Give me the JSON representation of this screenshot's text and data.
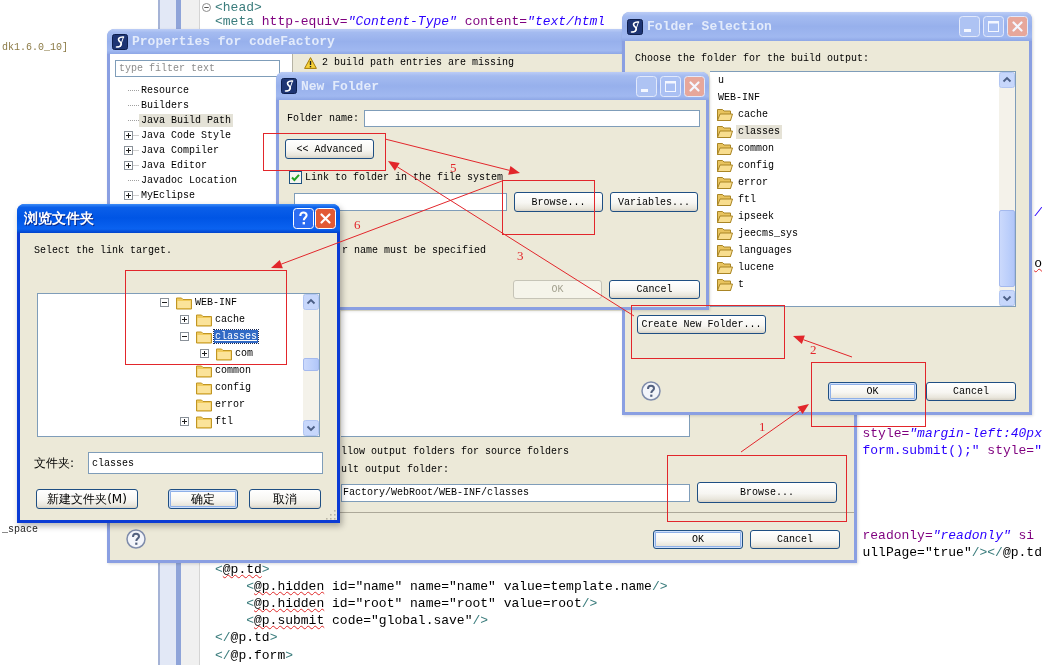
{
  "editor": {
    "left_view": {
      "lines": [
        {
          "text": "dk1.6.0_10]",
          "kind": "decoration"
        },
        {
          "text": "_space",
          "kind": "name"
        }
      ]
    },
    "code_lines": [
      {
        "expanded": true,
        "parts": [
          {
            "kind": "tag",
            "text": "<head>",
            "warning": false
          }
        ]
      },
      {
        "parts": [
          {
            "kind": "tag",
            "text": "<meta",
            "warning": false
          },
          {
            "kind": "attr",
            "text": " http-equiv=",
            "warning": false
          },
          {
            "kind": "value",
            "text": "\"Content-Type\"",
            "warning": false
          },
          {
            "kind": "attr",
            "text": " content=",
            "warning": false
          },
          {
            "kind": "value",
            "text": "\"text/html",
            "warning": false
          }
        ]
      },
      {
        "parts": [
          {
            "kind": "value",
            "text": "/",
            "warning": false
          }
        ]
      },
      {
        "parts": [
          {
            "kind": "text",
            "text": "o",
            "warning": true
          }
        ]
      },
      {
        "parts": [
          {
            "kind": "attr",
            "text": "style=",
            "warning": false
          },
          {
            "kind": "value",
            "text": "\"margin-left:40px",
            "warning": false
          }
        ]
      },
      {
        "parts": [
          {
            "kind": "script",
            "text": "form.submit();\"",
            "warning": false
          },
          {
            "kind": "attr",
            "text": " style=",
            "warning": false
          },
          {
            "kind": "script",
            "text": "\"",
            "warning": false
          }
        ]
      },
      {
        "parts": [
          {
            "kind": "attr",
            "text": "readonly=",
            "warning": false
          },
          {
            "kind": "value",
            "text": "\"readonly\"",
            "warning": false
          },
          {
            "kind": "attr",
            "text": " si",
            "warning": false
          }
        ]
      },
      {
        "parts": [
          {
            "kind": "text",
            "text": "ullPage=\"true\"",
            "warning": false
          },
          {
            "kind": "tag",
            "text": "/></",
            "warning": false
          },
          {
            "kind": "text",
            "text": "@p.td",
            "warning": false
          }
        ]
      },
      {
        "parts": [
          {
            "kind": "tag",
            "text": "<",
            "warning": false
          },
          {
            "kind": "text",
            "text": "@p.td",
            "warning": true
          },
          {
            "kind": "tag",
            "text": ">",
            "warning": false
          }
        ]
      },
      {
        "parts": [
          {
            "kind": "tag",
            "text": "<",
            "warning": false
          },
          {
            "kind": "text",
            "text": "@p.hidden",
            "warning": true
          },
          {
            "kind": "text",
            "text": " id=\"name\" name=\"name\" value=template.name",
            "warning": false
          },
          {
            "kind": "tag",
            "text": "/>",
            "warning": false
          }
        ]
      },
      {
        "parts": [
          {
            "kind": "tag",
            "text": "<",
            "warning": false
          },
          {
            "kind": "text",
            "text": "@p.hidden",
            "warning": true
          },
          {
            "kind": "text",
            "text": " id=\"root\" name=\"root\" value=root",
            "warning": false
          },
          {
            "kind": "tag",
            "text": "/>",
            "warning": false
          }
        ]
      },
      {
        "parts": [
          {
            "kind": "tag",
            "text": "<",
            "warning": false
          },
          {
            "kind": "text",
            "text": "@p.submit",
            "warning": true
          },
          {
            "kind": "text",
            "text": " code=\"global.save\"",
            "warning": false
          },
          {
            "kind": "tag",
            "text": "/>",
            "warning": false
          }
        ]
      },
      {
        "parts": [
          {
            "kind": "tag",
            "text": "</",
            "warning": false
          },
          {
            "kind": "text",
            "text": "@p.td",
            "warning": false
          },
          {
            "kind": "tag",
            "text": ">",
            "warning": false
          }
        ]
      },
      {
        "parts": [
          {
            "kind": "tag",
            "text": "</",
            "warning": false
          },
          {
            "kind": "text",
            "text": "@p.form",
            "warning": false
          },
          {
            "kind": "tag",
            "text": ">",
            "warning": false
          }
        ]
      }
    ]
  },
  "properties_dialog": {
    "title": "Properties for codeFactory",
    "active": false,
    "filter": {
      "placeholder": "type filter text"
    },
    "tree": [
      {
        "label": "Resource",
        "selected": false
      },
      {
        "label": "Builders",
        "selected": false
      },
      {
        "label": "Java Build Path",
        "selected": true
      },
      {
        "label": "Java Code Style",
        "expanded": false,
        "selected": false
      },
      {
        "label": "Java Compiler",
        "expanded": false,
        "selected": false
      },
      {
        "label": "Java Editor",
        "expanded": false,
        "selected": false
      },
      {
        "label": "Javadoc Location",
        "selected": false
      },
      {
        "label": "MyEclipse",
        "expanded": false,
        "selected": false
      }
    ],
    "warning": "2 build path entries are missing",
    "allow_output_folders": "llow output folders for source folders",
    "default_output": {
      "label": "ult output folder:",
      "value": "Factory/WebRoot/WEB-INF/classes",
      "button": "Browse..."
    },
    "buttons": [
      {
        "label": "OK",
        "default": true
      },
      {
        "label": "Cancel",
        "default": false
      }
    ]
  },
  "folder_selection": {
    "title": "Folder Selection",
    "active": false,
    "prompt": "Choose the folder for the build output:",
    "tree": [
      {
        "label": "u",
        "selected": false
      },
      {
        "label": "WEB-INF",
        "selected": false,
        "children": [
          {
            "label": "cache",
            "selected": false
          },
          {
            "label": "classes",
            "selected": true
          },
          {
            "label": "common",
            "selected": false
          },
          {
            "label": "config",
            "selected": false
          },
          {
            "label": "error",
            "selected": false
          },
          {
            "label": "ftl",
            "selected": false
          },
          {
            "label": "ipseek",
            "selected": false
          },
          {
            "label": "jeecms_sys",
            "selected": false
          },
          {
            "label": "languages",
            "selected": false
          },
          {
            "label": "lucene",
            "selected": false
          },
          {
            "label": "t",
            "selected": false
          }
        ]
      }
    ],
    "create_button": "Create New Folder...",
    "buttons": [
      {
        "label": "OK",
        "default": true
      },
      {
        "label": "Cancel",
        "default": false
      }
    ]
  },
  "new_folder": {
    "title": "New Folder",
    "active": false,
    "name_label": "Folder name:",
    "advanced_button": "<< Advanced",
    "link_checkbox": {
      "label": "Link to folder in the file system",
      "checked": true
    },
    "location_buttons": [
      "Browse...",
      "Variables..."
    ],
    "message": "r name must be specified",
    "buttons": [
      {
        "label": "OK",
        "disabled": true
      },
      {
        "label": "Cancel",
        "disabled": false
      }
    ]
  },
  "browse_folder": {
    "title": "浏览文件夹",
    "active": true,
    "prompt": "Select the link target.",
    "tree": [
      {
        "label": "WEB-INF",
        "expanded": true,
        "selected": false,
        "children": [
          {
            "label": "cache",
            "expanded": false,
            "selected": false
          },
          {
            "label": "classes",
            "expanded": true,
            "selected": true,
            "children": [
              {
                "label": "com",
                "expanded": false,
                "selected": false
              }
            ]
          },
          {
            "label": "common",
            "selected": false
          },
          {
            "label": "config",
            "selected": false
          },
          {
            "label": "error",
            "selected": false
          },
          {
            "label": "ftl",
            "expanded": false,
            "selected": false
          }
        ]
      }
    ],
    "folder_label": "文件夹:",
    "folder_value": "classes",
    "buttons": [
      {
        "label": "新建文件夹(M)",
        "default": false
      },
      {
        "label": "确定",
        "default": true
      },
      {
        "label": "取消",
        "default": false
      }
    ]
  },
  "annotations": [
    {
      "label": "1"
    },
    {
      "label": "2"
    },
    {
      "label": "3"
    },
    {
      "label": "5"
    },
    {
      "label": "6"
    }
  ]
}
